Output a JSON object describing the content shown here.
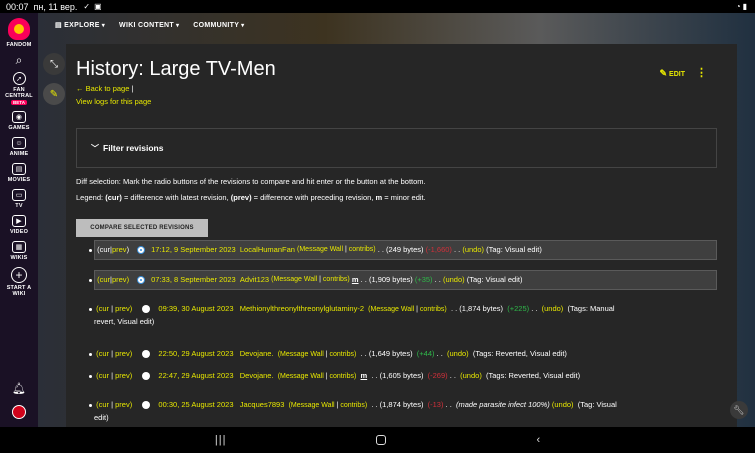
{
  "statusbar": {
    "time": "00:07",
    "date": "пн, 11 вер."
  },
  "sidebar": {
    "brand": "FANDOM",
    "fan_central": "FAN\nCENTRAL",
    "beta": "BETA",
    "items": [
      "GAMES",
      "ANIME",
      "MOVIES",
      "TV",
      "VIDEO",
      "WIKIS"
    ],
    "start_wiki": "START A\nWIKI"
  },
  "topnav": {
    "explore": "EXPLORE",
    "wiki_content": "WIKI CONTENT",
    "community": "COMMUNITY"
  },
  "page": {
    "title": "History: Large TV-Men",
    "edit": "EDIT",
    "back": "Back to page",
    "back_sep": "|",
    "logs": "View logs for this page"
  },
  "filter": {
    "label": "Filter revisions"
  },
  "diff_text": "Diff selection: Mark the radio buttons of the revisions to compare and hit enter or the button at the bottom.",
  "legend": {
    "prefix": "Legend: ",
    "cur": "(cur)",
    "cur_desc": " = difference with latest revision, ",
    "prev": "(prev)",
    "prev_desc": " = difference with preceding revision, ",
    "m": "m",
    "m_desc": " = minor edit."
  },
  "compare_button": "COMPARE SELECTED REVISIONS",
  "revisions": [
    {
      "date": "17:12, 9 September 2023",
      "user": "LocalHumanFan",
      "wall": "(Message Wall",
      "contribs": "contribs)",
      "size": ". . (249 bytes)",
      "diff": "(-1,660)",
      "undo": "(undo)",
      "tag": "(Tag: Visual edit)"
    },
    {
      "date": "07:33, 8 September 2023",
      "user": "Advit123",
      "wall": "(Message Wall",
      "contribs": "contribs)",
      "m": "m",
      "size": ". . (1,909 bytes)",
      "diff": "(+35)",
      "undo": "(undo)",
      "tag": "(Tag: Visual edit)"
    },
    {
      "date": "09:39, 30 August 2023",
      "user": "Methionylthreonylthreonylglutaminy-2",
      "wall": "(Message Wall",
      "contribs": "contribs)",
      "size": ". . (1,874 bytes)",
      "diff": "(+225)",
      "undo": "(undo)",
      "tag": "(Tags: Manual",
      "tag2": "revert, Visual edit)"
    },
    {
      "date": "22:50, 29 August 2023",
      "user": "Devojane.",
      "wall": "(Message Wall",
      "contribs": "contribs)",
      "size": ". . (1,649 bytes)",
      "diff": "(+44)",
      "undo": "(undo)",
      "tag": "(Tags: Reverted, Visual edit)"
    },
    {
      "date": "22:47, 29 August 2023",
      "user": "Devojane.",
      "wall": "(Message Wall",
      "contribs": "contribs)",
      "m": "m",
      "size": ". . (1,605 bytes)",
      "diff": "(-269)",
      "undo": "(undo)",
      "tag": "(Tags: Reverted, Visual edit)"
    },
    {
      "date": "00:30, 25 August 2023",
      "user": "Jacques7893",
      "wall": "(Message Wall",
      "contribs": "contribs)",
      "size": ". . (1,874 bytes)",
      "diff": "(-13)",
      "summary": "(made parasite infect 100%)",
      "undo": "(undo)",
      "tag": "(Tag: Visual",
      "tag2": "edit)"
    }
  ],
  "cur_label": "cur",
  "prev_label": "prev",
  "colors": {
    "accent": "#e8e800",
    "positive": "#2fb84a",
    "negative": "#d0303a",
    "brand": "#fa005a"
  }
}
